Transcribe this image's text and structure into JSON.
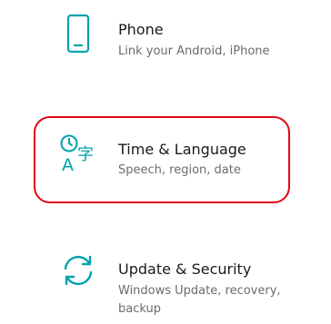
{
  "accent_color": "#00a2ad",
  "highlight_color": "#e00613",
  "tiles": [
    {
      "title": "Phone",
      "description": "Link your Android, iPhone",
      "icon": "phone-icon"
    },
    {
      "title": "Time & Language",
      "description": "Speech, region, date",
      "icon": "time-language-icon",
      "icon_glyph": "字",
      "highlighted": true
    },
    {
      "title": "Update & Security",
      "description": "Windows Update, recovery, backup",
      "icon": "update-sync-icon"
    }
  ]
}
